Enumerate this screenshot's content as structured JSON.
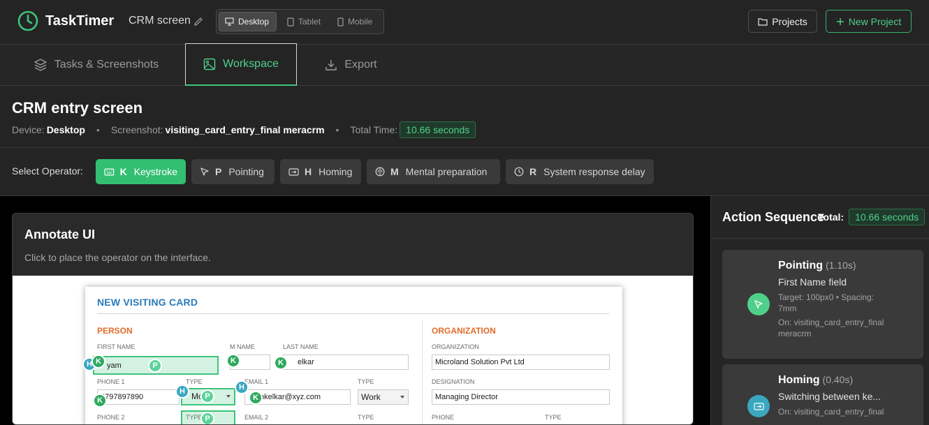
{
  "app": {
    "name": "TaskTimer",
    "project_name": "CRM screen",
    "brand_color": "#3cc47c"
  },
  "device_toggle": {
    "options": [
      "Desktop",
      "Tablet",
      "Mobile"
    ],
    "selected": "Desktop"
  },
  "header_buttons": {
    "projects": "Projects",
    "new_project": "New Project"
  },
  "tabs": [
    {
      "label": "Tasks & Screenshots",
      "icon": "layers-icon",
      "active": false
    },
    {
      "label": "Workspace",
      "icon": "image-icon",
      "active": true
    },
    {
      "label": "Export",
      "icon": "download-icon",
      "active": false
    }
  ],
  "page": {
    "title": "CRM entry screen",
    "device_label": "Device:",
    "device_value": "Desktop",
    "screenshot_label": "Screenshot:",
    "screenshot_value": "visiting_card_entry_final meracrm",
    "total_label": "Total Time:",
    "total_value": "10.66 seconds"
  },
  "operators": {
    "label": "Select Operator:",
    "items": [
      {
        "key": "K",
        "label": "Keystroke",
        "icon": "keyboard-icon",
        "active": true
      },
      {
        "key": "P",
        "label": "Pointing",
        "icon": "pointer-icon",
        "active": false
      },
      {
        "key": "H",
        "label": "Homing",
        "icon": "homing-icon",
        "active": false
      },
      {
        "key": "M",
        "label": "Mental preparation",
        "icon": "brain-icon",
        "active": false
      },
      {
        "key": "R",
        "label": "System response delay",
        "icon": "clock-icon",
        "active": false
      }
    ]
  },
  "annotate": {
    "title": "Annotate UI",
    "subtitle": "Click to place the operator on the interface."
  },
  "form": {
    "title": "NEW VISITING CARD",
    "person_section": "PERSON",
    "org_section": "ORGANIZATION",
    "labels": {
      "first_name": "FIRST NAME",
      "m_name": "M NAME",
      "last_name": "LAST NAME",
      "phone1": "PHONE 1",
      "type": "TYPE",
      "email1": "EMAIL 1",
      "phone2": "PHONE 2",
      "email2": "EMAIL 2",
      "organization": "ORGANIZATION",
      "designation": "DESIGNATION",
      "phone": "PHONE"
    },
    "values": {
      "first_name": "yam",
      "last_name": "elkar",
      "phone1": "9797897890",
      "phone1_type": "Mo",
      "email1": "mkelkar@xyz.com",
      "email1_type": "Work",
      "organization": "Microland Solution Pvt Ltd",
      "designation": "Managing Director"
    }
  },
  "sequence": {
    "title": "Action Sequence",
    "total_label": "Total:",
    "total_value": "10.66 seconds",
    "items": [
      {
        "name": "Pointing",
        "duration": "(1.10s)",
        "description": "First Name field",
        "target": "Target: 100px0 • Spacing: 7mm",
        "on": "On: visiting_card_entry_final meracrm",
        "icon": "pointer-icon",
        "color": "#4fd08a"
      },
      {
        "name": "Homing",
        "duration": "(0.40s)",
        "description": "Switching between ke...",
        "on": "On: visiting_card_entry_final",
        "icon": "homing-icon",
        "color": "#3aa7bf"
      }
    ]
  }
}
